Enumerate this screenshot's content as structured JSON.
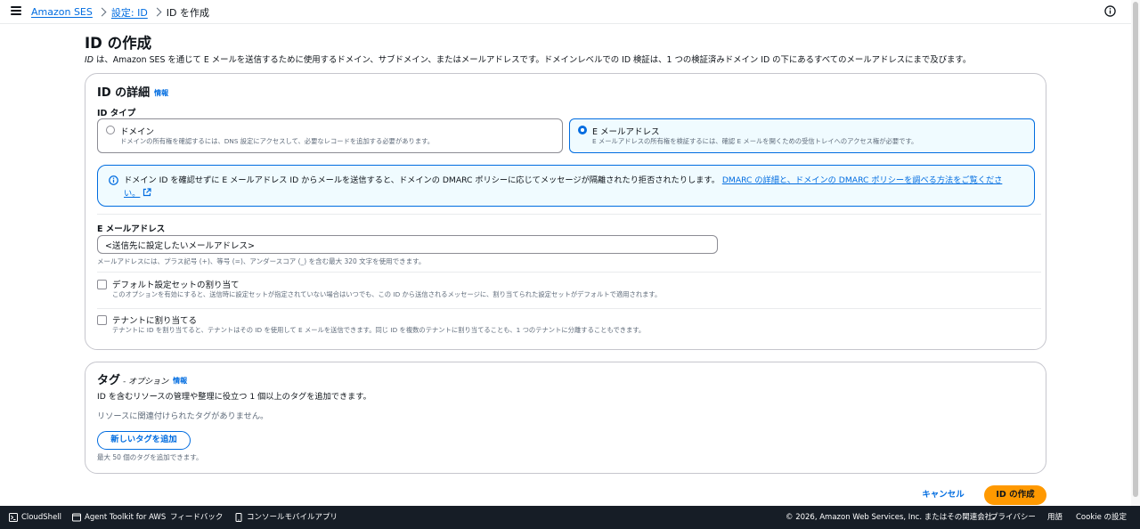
{
  "breadcrumb": {
    "items": [
      "Amazon SES",
      "設定: ID"
    ],
    "current": "ID を作成"
  },
  "page": {
    "title": "ID の作成",
    "description_italic": "ID",
    "description_rest": " は、Amazon SES を通じて E メールを送信するために使用するドメイン、サブドメイン、またはメールアドレスです。ドメインレベルでの ID 検証は、1 つの検証済みドメイン ID の下にあるすべてのメールアドレスにまで及びます。"
  },
  "details": {
    "heading": "ID の詳細",
    "info_label": "情報",
    "identity_type_label": "ID タイプ",
    "options": [
      {
        "title": "ドメイン",
        "description": "ドメインの所有権を確認するには、DNS 設定にアクセスして、必要なレコードを追加する必要があります。",
        "selected": false
      },
      {
        "title": "E メールアドレス",
        "description": "E メールアドレスの所有権を検証するには、確認 E メールを開くための受信トレイへのアクセス権が必要です。",
        "selected": true
      }
    ],
    "alert": {
      "text": "ドメイン ID を確認せずに E メールアドレス ID からメールを送信すると、ドメインの DMARC ポリシーに応じてメッセージが隔離されたり拒否されたりします。",
      "link": "DMARC の詳細と、ドメインの DMARC ポリシーを調べる方法をご覧ください。"
    },
    "email_label": "E メールアドレス",
    "email_value": "<送信先に設定したいメールアドレス>",
    "email_constraint": "メールアドレスには、プラス記号 (+)、等号 (=)、アンダースコア (_) を含む最大 320 文字を使用できます。",
    "default_config": {
      "label": "デフォルト設定セットの割り当て",
      "description": "このオプションを有効にすると、送信時に設定セットが指定されていない場合はいつでも、この ID から送信されるメッセージに、割り当てられた設定セットがデフォルトで適用されます。",
      "checked": false
    },
    "tenant": {
      "label": "テナントに割り当てる",
      "description": "テナントに ID を割り当てると、テナントはその ID を使用して E メールを送信できます。同じ ID を複数のテナントに割り当てることも、1 つのテナントに分離することもできます。",
      "checked": false
    }
  },
  "tags": {
    "heading": "タグ",
    "optional": "- オプション",
    "info_label": "情報",
    "description": "ID を含むリソースの管理や整理に役立つ 1 個以上のタグを追加できます。",
    "empty": "リソースに関連付けられたタグがありません。",
    "add_button": "新しいタグを追加",
    "limit": "最大 50 個のタグを追加できます。"
  },
  "actions": {
    "cancel": "キャンセル",
    "create": "ID の作成"
  },
  "footer": {
    "cloudshell": "CloudShell",
    "toolkit": "Agent Toolkit for AWS",
    "feedback": "フィードバック",
    "mobile": "コンソールモバイルアプリ",
    "copyright": "© 2026, Amazon Web Services, Inc. またはその関連会社。",
    "privacy": "プライバシー",
    "terms": "用語",
    "cookie": "Cookie の設定"
  },
  "colors": {
    "link": "#006ce0",
    "primary": "#ff9900",
    "footer_bg": "#161d26",
    "alert_bg": "#f0fbff"
  }
}
